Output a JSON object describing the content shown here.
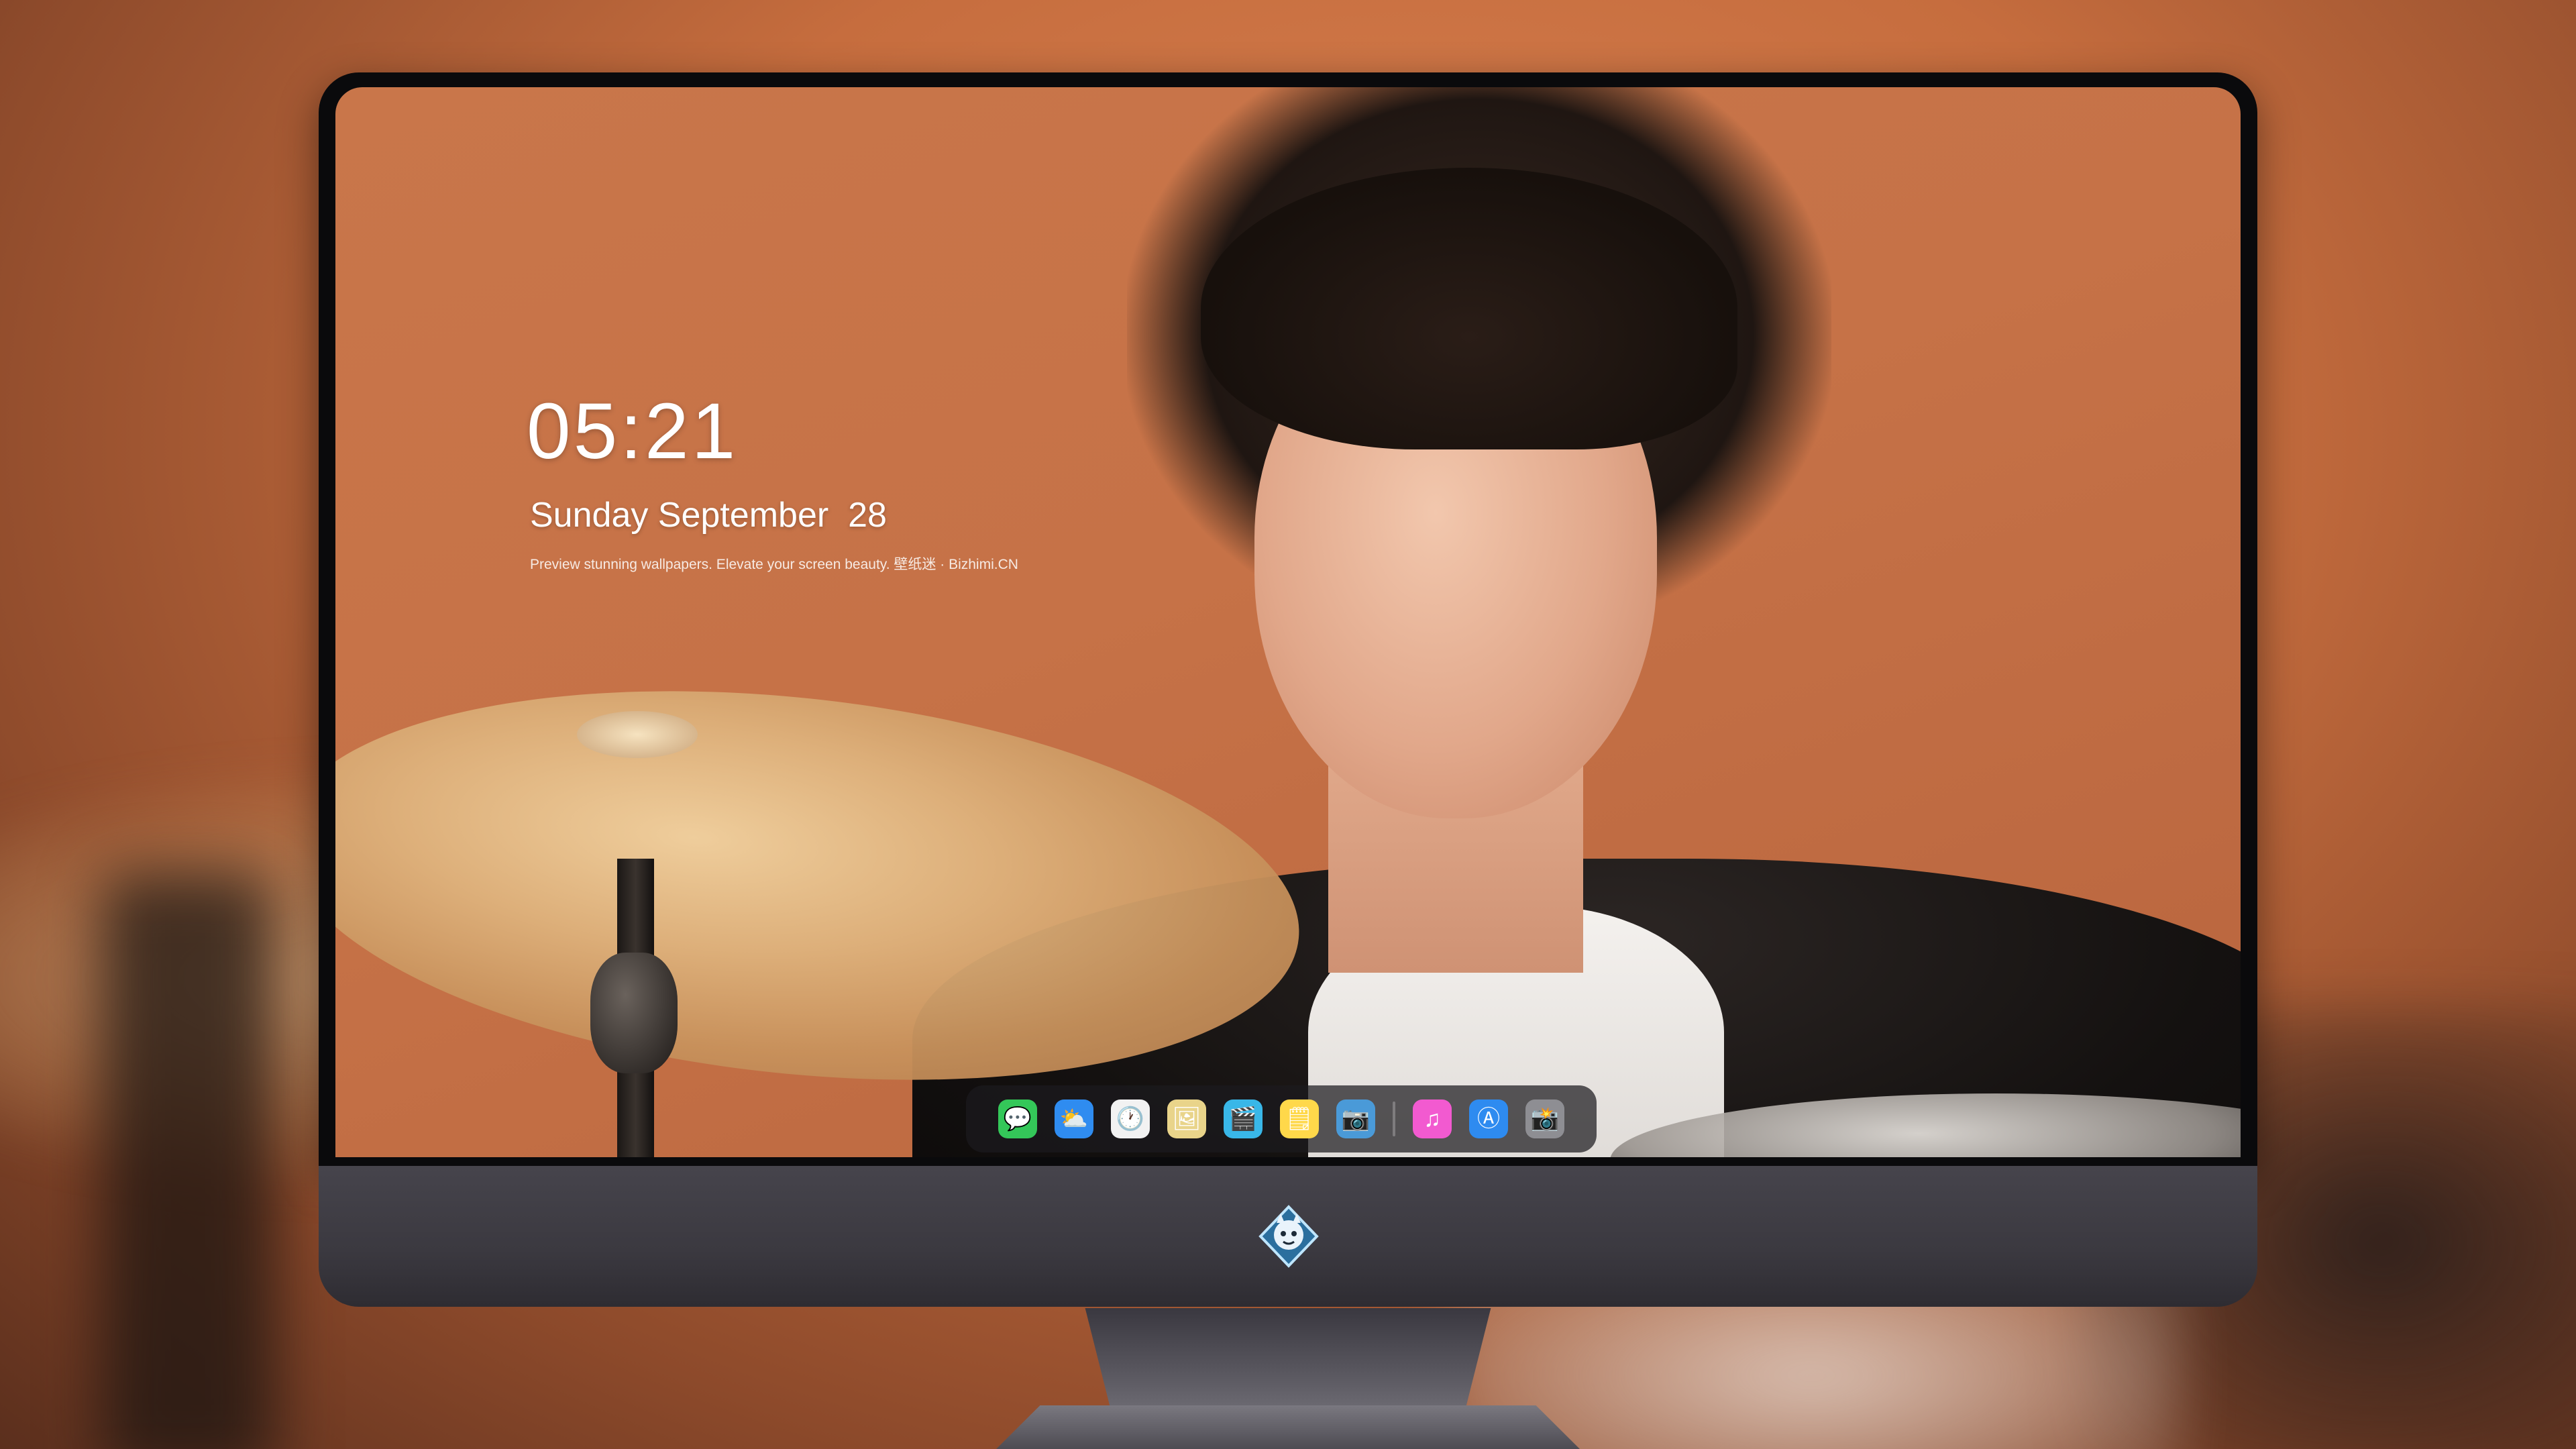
{
  "lock_screen": {
    "time": "05:21",
    "date": "Sunday September  28",
    "tagline": "Preview stunning wallpapers. Elevate your screen beauty. 壁纸迷 · Bizhimi.CN"
  },
  "dock": {
    "items": [
      {
        "name": "messages",
        "glyph": "💬",
        "color": "#34c759"
      },
      {
        "name": "weather",
        "glyph": "⛅",
        "color": "#2f8cf0"
      },
      {
        "name": "clock",
        "glyph": "🕐",
        "color": "#f2f2f2"
      },
      {
        "name": "preview",
        "glyph": "🖼",
        "color": "#e9d48a"
      },
      {
        "name": "claquette",
        "glyph": "🎬",
        "color": "#39b7e8"
      },
      {
        "name": "notes",
        "glyph": "🗒",
        "color": "#ffd84a"
      },
      {
        "name": "photo-booth",
        "glyph": "📷",
        "color": "#4a9ad8"
      },
      {
        "name": "itunes",
        "glyph": "♫",
        "color": "#f25ad0"
      },
      {
        "name": "app-store",
        "glyph": "Ⓐ",
        "color": "#2e8bf0"
      },
      {
        "name": "screenshot",
        "glyph": "📸",
        "color": "#8e8e93"
      }
    ]
  }
}
